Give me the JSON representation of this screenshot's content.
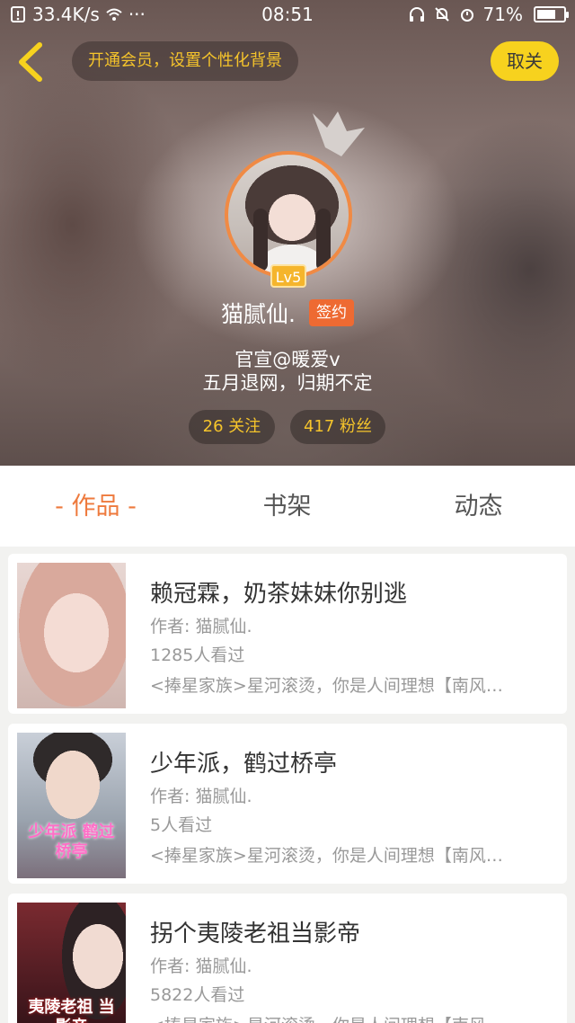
{
  "status_bar": {
    "network_speed": "33.4K/s",
    "more": "···",
    "time": "08:51",
    "battery": "71%",
    "battery_level": 0.71
  },
  "header": {
    "promo_text": "开通会员，设置个性化背景",
    "unfollow_label": "取关",
    "level": "Lv5",
    "username": "猫腻仙.",
    "sign_badge": "签约",
    "bio_line1": "官宣@暖爱v",
    "bio_line2": "五月退网，归期不定",
    "following": "26 关注",
    "fans": "417 粉丝",
    "accent_color": "#f7d21e",
    "badge_color": "#ee6a32"
  },
  "tabs": [
    {
      "label": "- 作品 -",
      "active": true
    },
    {
      "label": "书架",
      "active": false
    },
    {
      "label": "动态",
      "active": false
    }
  ],
  "books": [
    {
      "title": "赖冠霖，奶茶妹妹你别逃",
      "author": "作者: 猫腻仙.",
      "views": "1285人看过",
      "tags": "<捧星家族>星河滚烫，你是人间理想【南风…",
      "cover_text": ""
    },
    {
      "title": "少年派，鹤过桥亭",
      "author": "作者: 猫腻仙.",
      "views": "5人看过",
      "tags": "<捧星家族>星河滚烫，你是人间理想【南风…",
      "cover_text": "少年派 鹤过桥亭"
    },
    {
      "title": "拐个夷陵老祖当影帝",
      "author": "作者: 猫腻仙.",
      "views": "5822人看过",
      "tags": "<捧星家族>星河滚烫，你是人间理想【南风…",
      "cover_text": "夷陵老祖 当影帝"
    }
  ]
}
